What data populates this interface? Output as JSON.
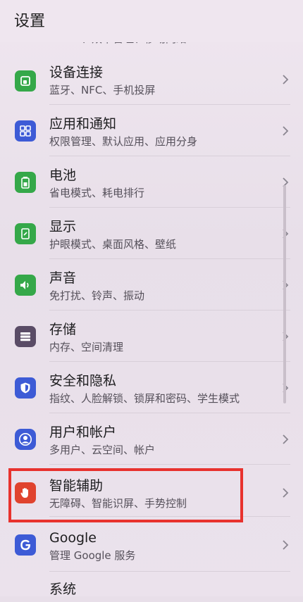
{
  "header": {
    "title": "设置"
  },
  "partial_item": {
    "sub": "WLAN、双卡管理、移动网络"
  },
  "items": [
    {
      "label": "设备连接",
      "sub": "蓝牙、NFC、手机投屏",
      "icon": "device-connect-icon",
      "color": "#35a849"
    },
    {
      "label": "应用和通知",
      "sub": "权限管理、默认应用、应用分身",
      "icon": "apps-grid-icon",
      "color": "#3d5bd6"
    },
    {
      "label": "电池",
      "sub": "省电模式、耗电排行",
      "icon": "battery-icon",
      "color": "#35a849"
    },
    {
      "label": "显示",
      "sub": "护眼模式、桌面风格、壁纸",
      "icon": "display-icon",
      "color": "#35a849"
    },
    {
      "label": "声音",
      "sub": "免打扰、铃声、振动",
      "icon": "speaker-icon",
      "color": "#35a849"
    },
    {
      "label": "存储",
      "sub": "内存、空间清理",
      "icon": "storage-icon",
      "color": "#5a4c66"
    },
    {
      "label": "安全和隐私",
      "sub": "指纹、人脸解锁、锁屏和密码、学生模式",
      "icon": "shield-icon",
      "color": "#3d5bd6"
    },
    {
      "label": "用户和帐户",
      "sub": "多用户、云空间、帐户",
      "icon": "user-account-icon",
      "color": "#3d5bd6"
    },
    {
      "label": "智能辅助",
      "sub": "无障碍、智能识屏、手势控制",
      "icon": "hand-icon",
      "color": "#e0432e"
    },
    {
      "label": "Google",
      "sub": "管理 Google 服务",
      "icon": "google-icon",
      "color": "#3d5bd6"
    },
    {
      "label": "系统",
      "sub": "",
      "icon": "system-icon",
      "color": "#5a5a66"
    }
  ],
  "highlighted_item": "智能辅助"
}
